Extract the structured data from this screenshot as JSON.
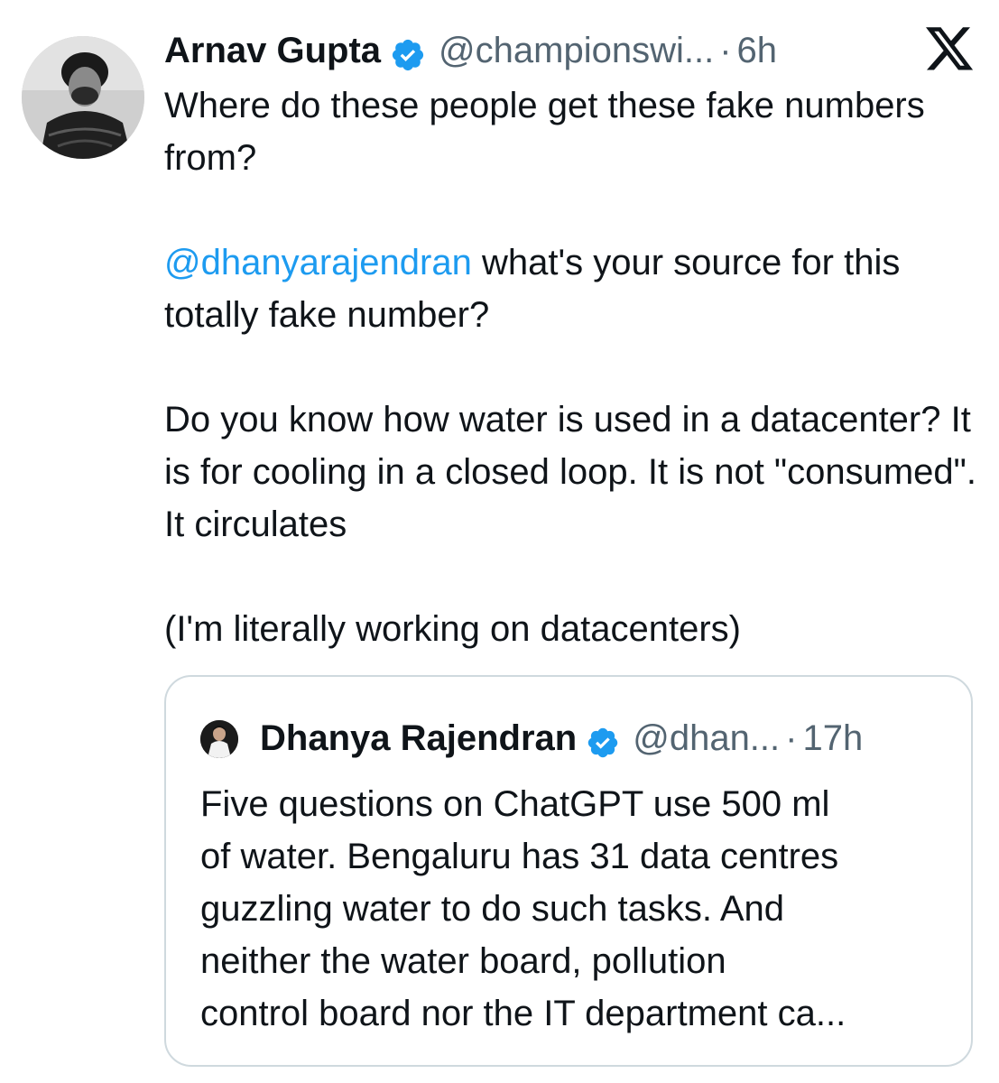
{
  "tweet": {
    "author_name": "Arnav Gupta",
    "handle": "@championswi...",
    "separator": "·",
    "time": "6h",
    "verified_icon": "verified-badge-icon",
    "platform_icon": "x-logo-icon",
    "paragraphs": [
      {
        "text": "Where do these people get these fake numbers from?"
      },
      {
        "mention": "@dhanyarajendran",
        "text": " what's your source for this totally fake number?"
      },
      {
        "text": "Do you know how water is used in a datacenter? It is for cooling in a closed loop. It is not \"consumed\". It circulates"
      },
      {
        "text": "(I'm literally working on datacenters)"
      }
    ]
  },
  "quote": {
    "author_name": "Dhanya Rajendran",
    "handle": "@dhan...",
    "separator": "·",
    "time": "17h",
    "verified_icon": "verified-badge-icon",
    "lines": [
      "Five questions on ChatGPT use 500 ml",
      "of water. Bengaluru has 31 data centres",
      "guzzling water to do such tasks. And",
      "neither the water board, pollution",
      "control board nor the IT department ca..."
    ]
  },
  "colors": {
    "text": "#0f1419",
    "secondary": "#536471",
    "link": "#1d9bf0",
    "verified": "#1d9bf0",
    "border": "#cfd9de"
  }
}
